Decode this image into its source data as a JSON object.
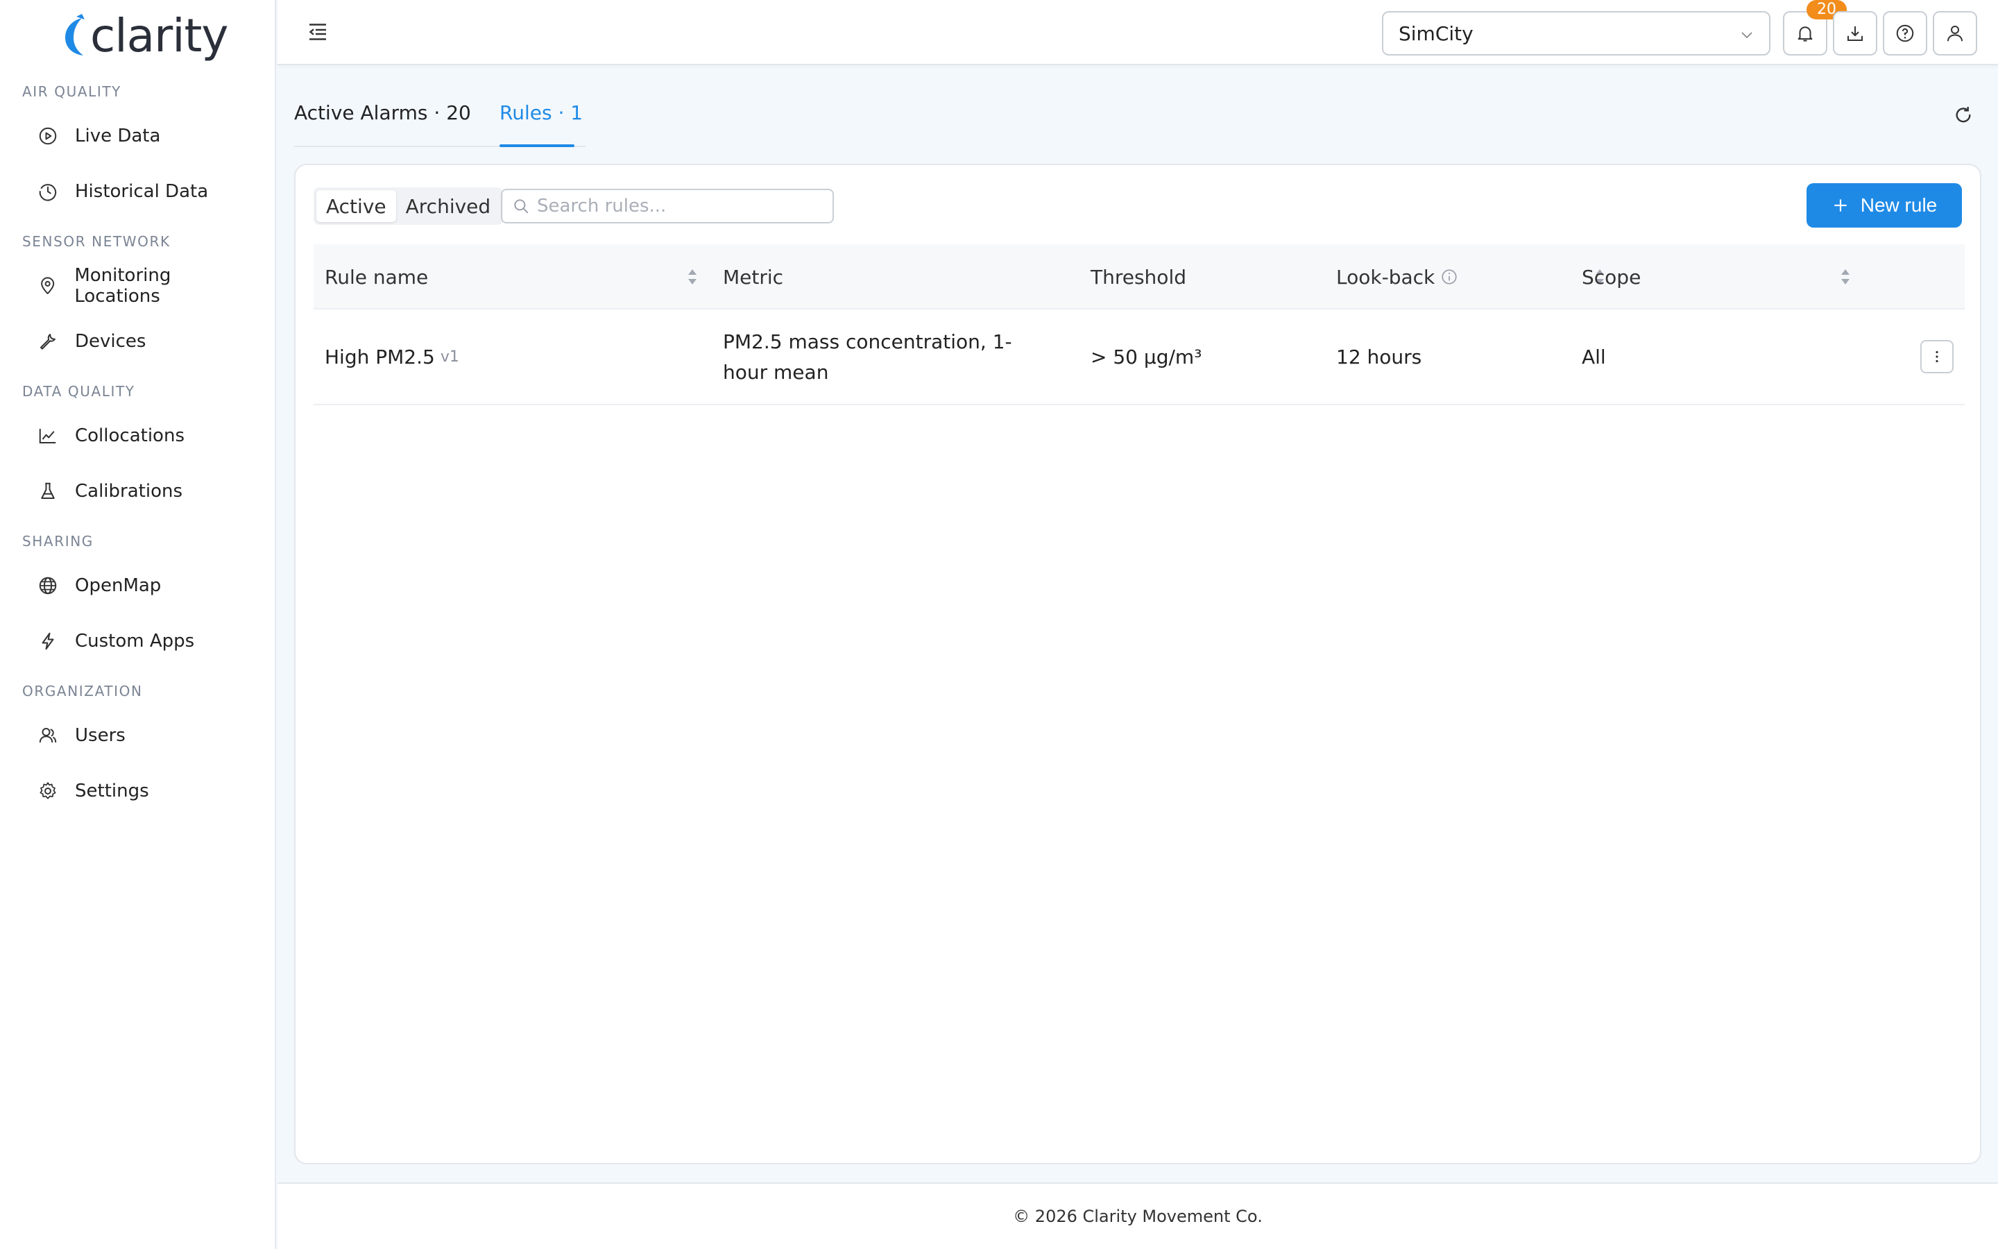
{
  "brand": {
    "name": "clarity"
  },
  "sidebar": {
    "sections": [
      {
        "title": "AIR QUALITY",
        "items": [
          {
            "label": "Live Data",
            "icon": "play-circle-icon"
          },
          {
            "label": "Historical Data",
            "icon": "clock-icon"
          }
        ]
      },
      {
        "title": "SENSOR NETWORK",
        "items": [
          {
            "label": "Monitoring Locations",
            "icon": "location-pin-icon"
          },
          {
            "label": "Devices",
            "icon": "wrench-icon"
          }
        ]
      },
      {
        "title": "DATA QUALITY",
        "items": [
          {
            "label": "Collocations",
            "icon": "line-chart-icon"
          },
          {
            "label": "Calibrations",
            "icon": "flask-icon"
          }
        ]
      },
      {
        "title": "SHARING",
        "items": [
          {
            "label": "OpenMap",
            "icon": "globe-icon"
          },
          {
            "label": "Custom Apps",
            "icon": "lightning-icon"
          }
        ]
      },
      {
        "title": "ORGANIZATION",
        "items": [
          {
            "label": "Users",
            "icon": "users-icon"
          },
          {
            "label": "Settings",
            "icon": "gear-icon"
          }
        ]
      }
    ]
  },
  "topbar": {
    "org_selected": "SimCity",
    "notification_count": "20",
    "icons": [
      "menu-collapse-icon",
      "bell-icon",
      "download-icon",
      "help-icon",
      "user-icon"
    ]
  },
  "tabs": [
    {
      "label": "Active Alarms · 20"
    },
    {
      "label": "Rules · 1"
    }
  ],
  "rules": {
    "filter": {
      "active": "Active",
      "archived": "Archived"
    },
    "search_placeholder": "Search rules...",
    "new_rule_label": "New rule",
    "columns": {
      "rule_name": "Rule name",
      "metric": "Metric",
      "threshold": "Threshold",
      "lookback": "Look-back",
      "scope": "Scope"
    },
    "rows": [
      {
        "name": "High PM2.5",
        "version": "v1",
        "metric": "PM2.5 mass concentration, 1-hour mean",
        "threshold": "> 50 µg/m³",
        "lookback": "12 hours",
        "scope": "All"
      }
    ]
  },
  "footer": {
    "text": "© 2026 Clarity Movement Co."
  },
  "colors": {
    "accent": "#1f8ae6",
    "badge": "#f28c1b"
  }
}
